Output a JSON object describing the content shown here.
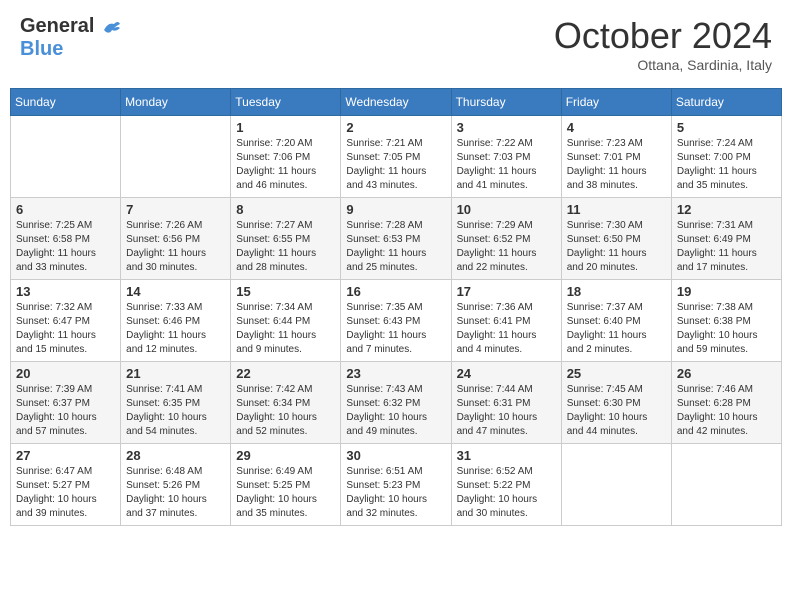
{
  "header": {
    "logo_line1": "General",
    "logo_line2": "Blue",
    "month_title": "October 2024",
    "subtitle": "Ottana, Sardinia, Italy"
  },
  "weekdays": [
    "Sunday",
    "Monday",
    "Tuesday",
    "Wednesday",
    "Thursday",
    "Friday",
    "Saturday"
  ],
  "weeks": [
    [
      {
        "day": "",
        "sunrise": "",
        "sunset": "",
        "daylight": ""
      },
      {
        "day": "",
        "sunrise": "",
        "sunset": "",
        "daylight": ""
      },
      {
        "day": "1",
        "sunrise": "Sunrise: 7:20 AM",
        "sunset": "Sunset: 7:06 PM",
        "daylight": "Daylight: 11 hours and 46 minutes."
      },
      {
        "day": "2",
        "sunrise": "Sunrise: 7:21 AM",
        "sunset": "Sunset: 7:05 PM",
        "daylight": "Daylight: 11 hours and 43 minutes."
      },
      {
        "day": "3",
        "sunrise": "Sunrise: 7:22 AM",
        "sunset": "Sunset: 7:03 PM",
        "daylight": "Daylight: 11 hours and 41 minutes."
      },
      {
        "day": "4",
        "sunrise": "Sunrise: 7:23 AM",
        "sunset": "Sunset: 7:01 PM",
        "daylight": "Daylight: 11 hours and 38 minutes."
      },
      {
        "day": "5",
        "sunrise": "Sunrise: 7:24 AM",
        "sunset": "Sunset: 7:00 PM",
        "daylight": "Daylight: 11 hours and 35 minutes."
      }
    ],
    [
      {
        "day": "6",
        "sunrise": "Sunrise: 7:25 AM",
        "sunset": "Sunset: 6:58 PM",
        "daylight": "Daylight: 11 hours and 33 minutes."
      },
      {
        "day": "7",
        "sunrise": "Sunrise: 7:26 AM",
        "sunset": "Sunset: 6:56 PM",
        "daylight": "Daylight: 11 hours and 30 minutes."
      },
      {
        "day": "8",
        "sunrise": "Sunrise: 7:27 AM",
        "sunset": "Sunset: 6:55 PM",
        "daylight": "Daylight: 11 hours and 28 minutes."
      },
      {
        "day": "9",
        "sunrise": "Sunrise: 7:28 AM",
        "sunset": "Sunset: 6:53 PM",
        "daylight": "Daylight: 11 hours and 25 minutes."
      },
      {
        "day": "10",
        "sunrise": "Sunrise: 7:29 AM",
        "sunset": "Sunset: 6:52 PM",
        "daylight": "Daylight: 11 hours and 22 minutes."
      },
      {
        "day": "11",
        "sunrise": "Sunrise: 7:30 AM",
        "sunset": "Sunset: 6:50 PM",
        "daylight": "Daylight: 11 hours and 20 minutes."
      },
      {
        "day": "12",
        "sunrise": "Sunrise: 7:31 AM",
        "sunset": "Sunset: 6:49 PM",
        "daylight": "Daylight: 11 hours and 17 minutes."
      }
    ],
    [
      {
        "day": "13",
        "sunrise": "Sunrise: 7:32 AM",
        "sunset": "Sunset: 6:47 PM",
        "daylight": "Daylight: 11 hours and 15 minutes."
      },
      {
        "day": "14",
        "sunrise": "Sunrise: 7:33 AM",
        "sunset": "Sunset: 6:46 PM",
        "daylight": "Daylight: 11 hours and 12 minutes."
      },
      {
        "day": "15",
        "sunrise": "Sunrise: 7:34 AM",
        "sunset": "Sunset: 6:44 PM",
        "daylight": "Daylight: 11 hours and 9 minutes."
      },
      {
        "day": "16",
        "sunrise": "Sunrise: 7:35 AM",
        "sunset": "Sunset: 6:43 PM",
        "daylight": "Daylight: 11 hours and 7 minutes."
      },
      {
        "day": "17",
        "sunrise": "Sunrise: 7:36 AM",
        "sunset": "Sunset: 6:41 PM",
        "daylight": "Daylight: 11 hours and 4 minutes."
      },
      {
        "day": "18",
        "sunrise": "Sunrise: 7:37 AM",
        "sunset": "Sunset: 6:40 PM",
        "daylight": "Daylight: 11 hours and 2 minutes."
      },
      {
        "day": "19",
        "sunrise": "Sunrise: 7:38 AM",
        "sunset": "Sunset: 6:38 PM",
        "daylight": "Daylight: 10 hours and 59 minutes."
      }
    ],
    [
      {
        "day": "20",
        "sunrise": "Sunrise: 7:39 AM",
        "sunset": "Sunset: 6:37 PM",
        "daylight": "Daylight: 10 hours and 57 minutes."
      },
      {
        "day": "21",
        "sunrise": "Sunrise: 7:41 AM",
        "sunset": "Sunset: 6:35 PM",
        "daylight": "Daylight: 10 hours and 54 minutes."
      },
      {
        "day": "22",
        "sunrise": "Sunrise: 7:42 AM",
        "sunset": "Sunset: 6:34 PM",
        "daylight": "Daylight: 10 hours and 52 minutes."
      },
      {
        "day": "23",
        "sunrise": "Sunrise: 7:43 AM",
        "sunset": "Sunset: 6:32 PM",
        "daylight": "Daylight: 10 hours and 49 minutes."
      },
      {
        "day": "24",
        "sunrise": "Sunrise: 7:44 AM",
        "sunset": "Sunset: 6:31 PM",
        "daylight": "Daylight: 10 hours and 47 minutes."
      },
      {
        "day": "25",
        "sunrise": "Sunrise: 7:45 AM",
        "sunset": "Sunset: 6:30 PM",
        "daylight": "Daylight: 10 hours and 44 minutes."
      },
      {
        "day": "26",
        "sunrise": "Sunrise: 7:46 AM",
        "sunset": "Sunset: 6:28 PM",
        "daylight": "Daylight: 10 hours and 42 minutes."
      }
    ],
    [
      {
        "day": "27",
        "sunrise": "Sunrise: 6:47 AM",
        "sunset": "Sunset: 5:27 PM",
        "daylight": "Daylight: 10 hours and 39 minutes."
      },
      {
        "day": "28",
        "sunrise": "Sunrise: 6:48 AM",
        "sunset": "Sunset: 5:26 PM",
        "daylight": "Daylight: 10 hours and 37 minutes."
      },
      {
        "day": "29",
        "sunrise": "Sunrise: 6:49 AM",
        "sunset": "Sunset: 5:25 PM",
        "daylight": "Daylight: 10 hours and 35 minutes."
      },
      {
        "day": "30",
        "sunrise": "Sunrise: 6:51 AM",
        "sunset": "Sunset: 5:23 PM",
        "daylight": "Daylight: 10 hours and 32 minutes."
      },
      {
        "day": "31",
        "sunrise": "Sunrise: 6:52 AM",
        "sunset": "Sunset: 5:22 PM",
        "daylight": "Daylight: 10 hours and 30 minutes."
      },
      {
        "day": "",
        "sunrise": "",
        "sunset": "",
        "daylight": ""
      },
      {
        "day": "",
        "sunrise": "",
        "sunset": "",
        "daylight": ""
      }
    ]
  ]
}
